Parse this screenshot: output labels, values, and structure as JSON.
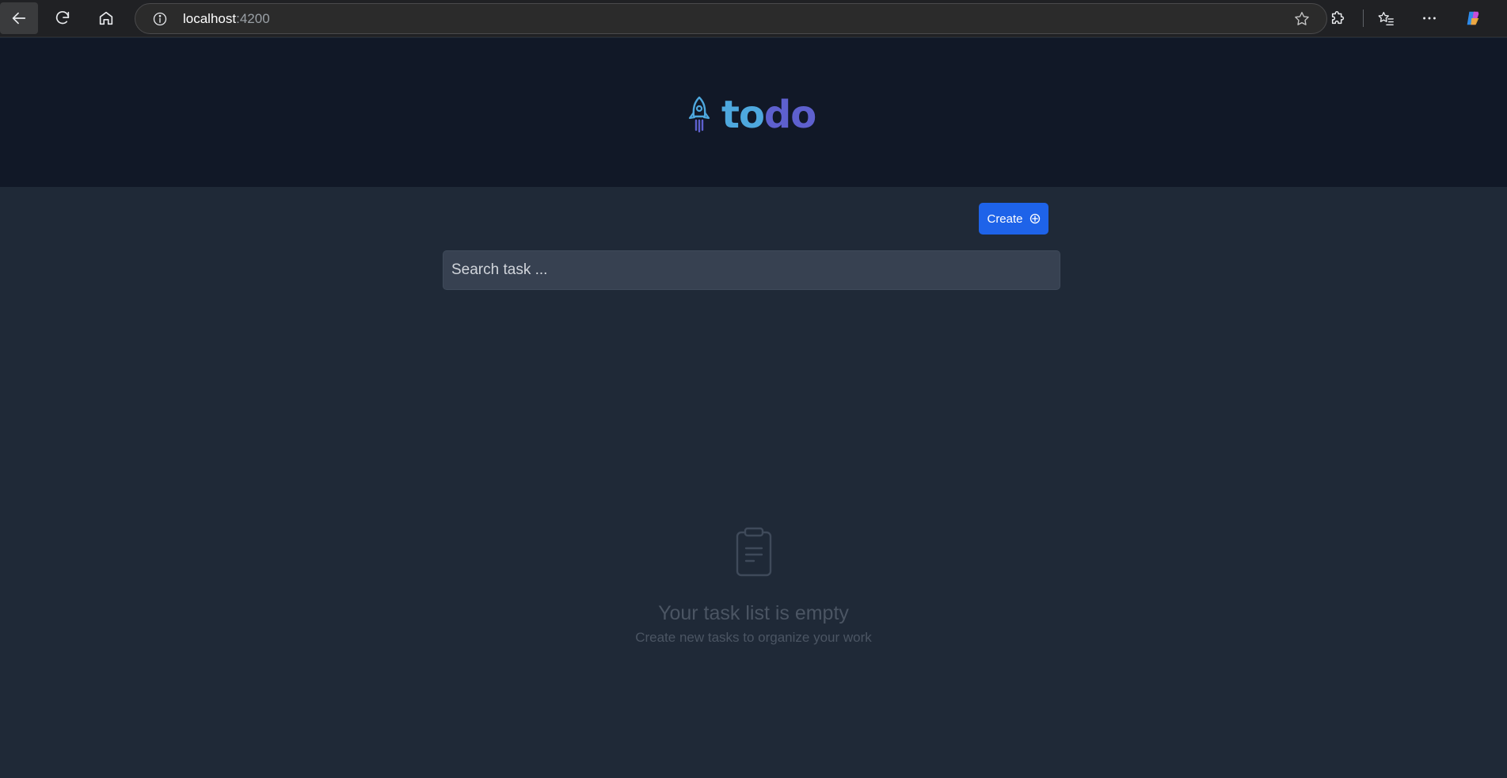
{
  "browser": {
    "url_host": "localhost",
    "url_port": ":4200"
  },
  "app": {
    "logo_part1": "to",
    "logo_part2": "do",
    "brand_colors": {
      "blue": "#4ea8de",
      "purple": "#5e60ce"
    }
  },
  "toolbar": {
    "create_label": "Create"
  },
  "search": {
    "placeholder": "Search task ..."
  },
  "empty_state": {
    "title": "Your task list is empty",
    "subtitle": "Create new tasks to organize your work"
  }
}
